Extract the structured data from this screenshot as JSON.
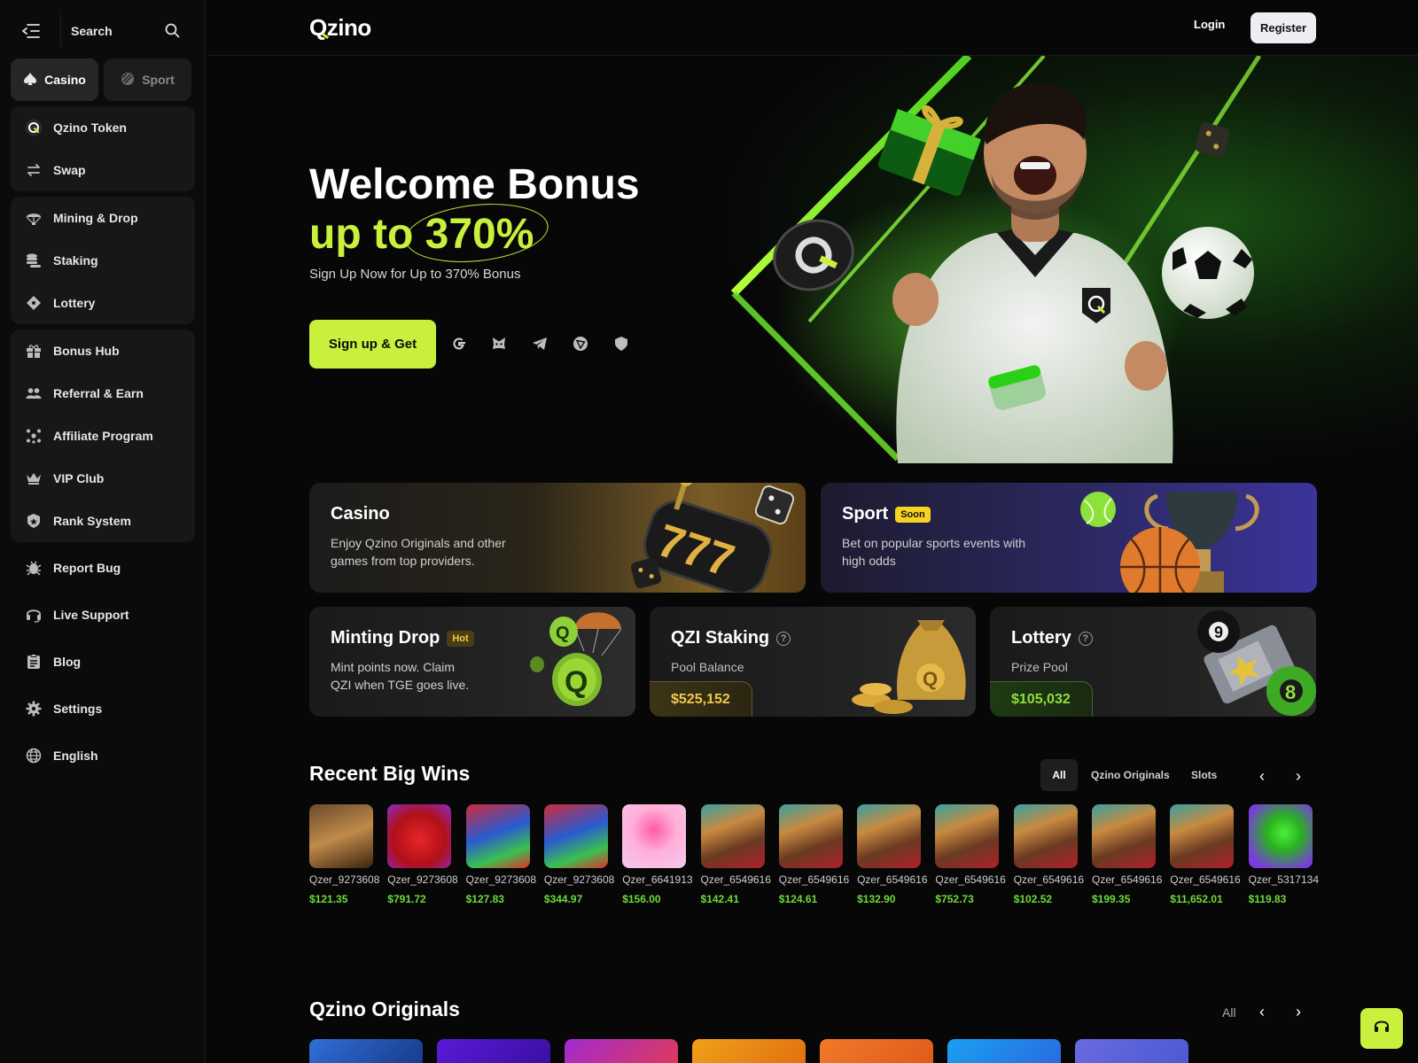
{
  "sidebar": {
    "search_label": "Search",
    "tabs": [
      {
        "label": "Casino",
        "icon": "spade-icon"
      },
      {
        "label": "Sport",
        "icon": "ball-icon"
      }
    ],
    "group1": [
      {
        "label": "Qzino Token",
        "icon": "qzino-token-icon"
      },
      {
        "label": "Swap",
        "icon": "swap-icon"
      }
    ],
    "group2": [
      {
        "label": "Mining & Drop",
        "icon": "parachute-icon"
      },
      {
        "label": "Staking",
        "icon": "coins-icon"
      },
      {
        "label": "Lottery",
        "icon": "ticket-icon"
      }
    ],
    "group3": [
      {
        "label": "Bonus Hub",
        "icon": "gift-icon"
      },
      {
        "label": "Referral & Earn",
        "icon": "users-icon"
      },
      {
        "label": "Affiliate Program",
        "icon": "network-icon"
      },
      {
        "label": "VIP Club",
        "icon": "crown-icon"
      },
      {
        "label": "Rank System",
        "icon": "rank-icon"
      }
    ],
    "solo": [
      {
        "label": "Report Bug",
        "icon": "bug-icon"
      },
      {
        "label": "Live Support",
        "icon": "headset-icon"
      },
      {
        "label": "Blog",
        "icon": "blog-icon"
      },
      {
        "label": "Settings",
        "icon": "gear-icon"
      },
      {
        "label": "English",
        "icon": "globe-icon"
      }
    ]
  },
  "header": {
    "logo_q": "Q",
    "logo_rest": "zino",
    "login": "Login",
    "register": "Register"
  },
  "hero": {
    "title_line1": "Welcome Bonus",
    "title_line2_prefix": "up to",
    "title_line2_highlight": "370%",
    "subtitle": "Sign Up Now for Up to 370% Bonus",
    "cta": "Sign up & Get",
    "social_icons": [
      "google-icon",
      "metamask-icon",
      "telegram-icon",
      "tron-icon",
      "shield-icon"
    ]
  },
  "cards": {
    "casino": {
      "title": "Casino",
      "desc1": "Enjoy Qzino Originals and other",
      "desc2": "games from top providers."
    },
    "sport": {
      "title": "Sport",
      "badge": "Soon",
      "desc1": "Bet on popular sports events with",
      "desc2": "high odds"
    },
    "minting": {
      "title": "Minting Drop",
      "badge": "Hot",
      "desc1": "Mint points now. Claim",
      "desc2": "QZI when TGE goes live."
    },
    "staking": {
      "title": "QZI Staking",
      "label": "Pool Balance",
      "value": "$525,152"
    },
    "lottery": {
      "title": "Lottery",
      "label": "Prize Pool",
      "value": "$105,032"
    }
  },
  "big_wins": {
    "title": "Recent Big Wins",
    "filters": [
      "All",
      "Qzino Originals",
      "Slots"
    ],
    "items": [
      {
        "user": "Qzer_9273608",
        "amount": "$121.35",
        "thumb": "cowboy"
      },
      {
        "user": "Qzer_9273608",
        "amount": "$791.72",
        "thumb": "strawberry"
      },
      {
        "user": "Qzer_9273608",
        "amount": "$127.83",
        "thumb": "dragon"
      },
      {
        "user": "Qzer_9273608",
        "amount": "$344.97",
        "thumb": "dragon"
      },
      {
        "user": "Qzer_6641913",
        "amount": "$156.00",
        "thumb": "candy"
      },
      {
        "user": "Qzer_6549616",
        "amount": "$142.41",
        "thumb": "king"
      },
      {
        "user": "Qzer_6549616",
        "amount": "$124.61",
        "thumb": "king"
      },
      {
        "user": "Qzer_6549616",
        "amount": "$132.90",
        "thumb": "king"
      },
      {
        "user": "Qzer_6549616",
        "amount": "$752.73",
        "thumb": "king"
      },
      {
        "user": "Qzer_6549616",
        "amount": "$102.52",
        "thumb": "king"
      },
      {
        "user": "Qzer_6549616",
        "amount": "$199.35",
        "thumb": "king"
      },
      {
        "user": "Qzer_6549616",
        "amount": "$11,652.01",
        "thumb": "king"
      },
      {
        "user": "Qzer_5317134",
        "amount": "$119.83",
        "thumb": "gem"
      }
    ]
  },
  "originals": {
    "title": "Qzino Originals",
    "all_label": "All"
  },
  "colors": {
    "accent": "#c8f03c",
    "win_green": "#6ddb3b",
    "sidebar_bg": "#0b0b0b",
    "group_bg": "#171717"
  }
}
